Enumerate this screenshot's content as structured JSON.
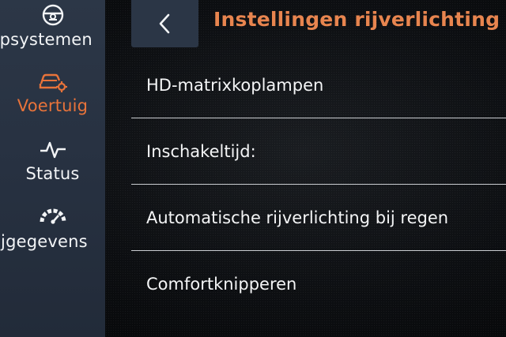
{
  "sidebar": {
    "items": [
      {
        "id": "assist",
        "label": "ulpsystemen",
        "icon": "steering-wheel-icon",
        "active": false
      },
      {
        "id": "vehicle",
        "label": "Voertuig",
        "icon": "car-settings-icon",
        "active": true
      },
      {
        "id": "status",
        "label": "Status",
        "icon": "pulse-icon",
        "active": false
      },
      {
        "id": "trip",
        "label": "rijgegevens",
        "icon": "gauge-icon",
        "active": false
      }
    ]
  },
  "header": {
    "back_icon": "chevron-left-icon",
    "title": "Instellingen rijverlichting"
  },
  "settings": {
    "items": [
      {
        "label": "HD-matrixkoplampen"
      },
      {
        "label": "Inschakeltijd:"
      },
      {
        "label": "Automatische rijverlichting bij regen"
      },
      {
        "label": "Comfortknipperen"
      }
    ]
  },
  "colors": {
    "accent": "#e8733a",
    "title": "#e8854f",
    "sidebar_bg": "#273141",
    "background": "#0d0f12"
  }
}
